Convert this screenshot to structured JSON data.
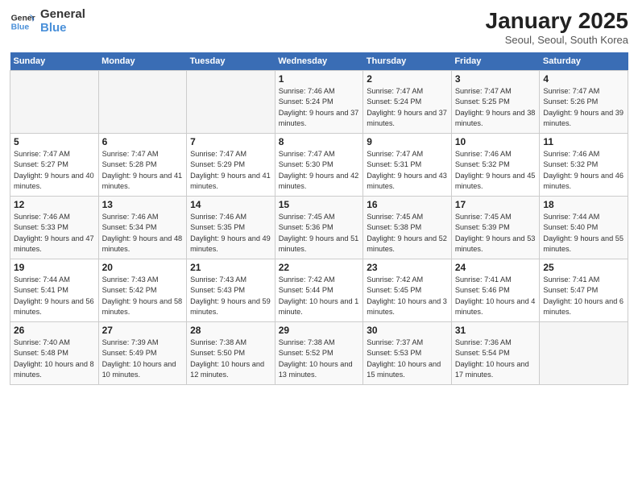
{
  "header": {
    "logo_general": "General",
    "logo_blue": "Blue",
    "month": "January 2025",
    "location": "Seoul, Seoul, South Korea"
  },
  "weekdays": [
    "Sunday",
    "Monday",
    "Tuesday",
    "Wednesday",
    "Thursday",
    "Friday",
    "Saturday"
  ],
  "weeks": [
    [
      {
        "day": "",
        "info": ""
      },
      {
        "day": "",
        "info": ""
      },
      {
        "day": "",
        "info": ""
      },
      {
        "day": "1",
        "info": "Sunrise: 7:46 AM\nSunset: 5:24 PM\nDaylight: 9 hours and 37 minutes."
      },
      {
        "day": "2",
        "info": "Sunrise: 7:47 AM\nSunset: 5:24 PM\nDaylight: 9 hours and 37 minutes."
      },
      {
        "day": "3",
        "info": "Sunrise: 7:47 AM\nSunset: 5:25 PM\nDaylight: 9 hours and 38 minutes."
      },
      {
        "day": "4",
        "info": "Sunrise: 7:47 AM\nSunset: 5:26 PM\nDaylight: 9 hours and 39 minutes."
      }
    ],
    [
      {
        "day": "5",
        "info": "Sunrise: 7:47 AM\nSunset: 5:27 PM\nDaylight: 9 hours and 40 minutes."
      },
      {
        "day": "6",
        "info": "Sunrise: 7:47 AM\nSunset: 5:28 PM\nDaylight: 9 hours and 41 minutes."
      },
      {
        "day": "7",
        "info": "Sunrise: 7:47 AM\nSunset: 5:29 PM\nDaylight: 9 hours and 41 minutes."
      },
      {
        "day": "8",
        "info": "Sunrise: 7:47 AM\nSunset: 5:30 PM\nDaylight: 9 hours and 42 minutes."
      },
      {
        "day": "9",
        "info": "Sunrise: 7:47 AM\nSunset: 5:31 PM\nDaylight: 9 hours and 43 minutes."
      },
      {
        "day": "10",
        "info": "Sunrise: 7:46 AM\nSunset: 5:32 PM\nDaylight: 9 hours and 45 minutes."
      },
      {
        "day": "11",
        "info": "Sunrise: 7:46 AM\nSunset: 5:32 PM\nDaylight: 9 hours and 46 minutes."
      }
    ],
    [
      {
        "day": "12",
        "info": "Sunrise: 7:46 AM\nSunset: 5:33 PM\nDaylight: 9 hours and 47 minutes."
      },
      {
        "day": "13",
        "info": "Sunrise: 7:46 AM\nSunset: 5:34 PM\nDaylight: 9 hours and 48 minutes."
      },
      {
        "day": "14",
        "info": "Sunrise: 7:46 AM\nSunset: 5:35 PM\nDaylight: 9 hours and 49 minutes."
      },
      {
        "day": "15",
        "info": "Sunrise: 7:45 AM\nSunset: 5:36 PM\nDaylight: 9 hours and 51 minutes."
      },
      {
        "day": "16",
        "info": "Sunrise: 7:45 AM\nSunset: 5:38 PM\nDaylight: 9 hours and 52 minutes."
      },
      {
        "day": "17",
        "info": "Sunrise: 7:45 AM\nSunset: 5:39 PM\nDaylight: 9 hours and 53 minutes."
      },
      {
        "day": "18",
        "info": "Sunrise: 7:44 AM\nSunset: 5:40 PM\nDaylight: 9 hours and 55 minutes."
      }
    ],
    [
      {
        "day": "19",
        "info": "Sunrise: 7:44 AM\nSunset: 5:41 PM\nDaylight: 9 hours and 56 minutes."
      },
      {
        "day": "20",
        "info": "Sunrise: 7:43 AM\nSunset: 5:42 PM\nDaylight: 9 hours and 58 minutes."
      },
      {
        "day": "21",
        "info": "Sunrise: 7:43 AM\nSunset: 5:43 PM\nDaylight: 9 hours and 59 minutes."
      },
      {
        "day": "22",
        "info": "Sunrise: 7:42 AM\nSunset: 5:44 PM\nDaylight: 10 hours and 1 minute."
      },
      {
        "day": "23",
        "info": "Sunrise: 7:42 AM\nSunset: 5:45 PM\nDaylight: 10 hours and 3 minutes."
      },
      {
        "day": "24",
        "info": "Sunrise: 7:41 AM\nSunset: 5:46 PM\nDaylight: 10 hours and 4 minutes."
      },
      {
        "day": "25",
        "info": "Sunrise: 7:41 AM\nSunset: 5:47 PM\nDaylight: 10 hours and 6 minutes."
      }
    ],
    [
      {
        "day": "26",
        "info": "Sunrise: 7:40 AM\nSunset: 5:48 PM\nDaylight: 10 hours and 8 minutes."
      },
      {
        "day": "27",
        "info": "Sunrise: 7:39 AM\nSunset: 5:49 PM\nDaylight: 10 hours and 10 minutes."
      },
      {
        "day": "28",
        "info": "Sunrise: 7:38 AM\nSunset: 5:50 PM\nDaylight: 10 hours and 12 minutes."
      },
      {
        "day": "29",
        "info": "Sunrise: 7:38 AM\nSunset: 5:52 PM\nDaylight: 10 hours and 13 minutes."
      },
      {
        "day": "30",
        "info": "Sunrise: 7:37 AM\nSunset: 5:53 PM\nDaylight: 10 hours and 15 minutes."
      },
      {
        "day": "31",
        "info": "Sunrise: 7:36 AM\nSunset: 5:54 PM\nDaylight: 10 hours and 17 minutes."
      },
      {
        "day": "",
        "info": ""
      }
    ]
  ]
}
